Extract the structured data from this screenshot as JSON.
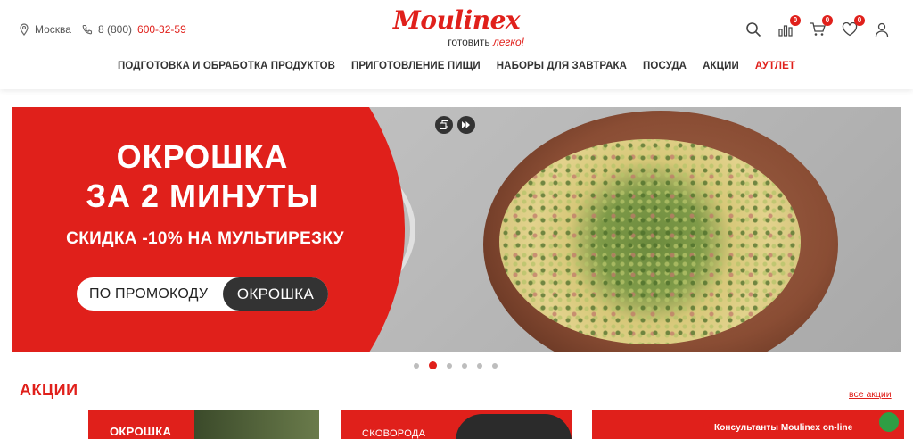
{
  "header": {
    "city": "Москва",
    "phone_prefix": "8 (800) ",
    "phone_number": "600-32-59",
    "brand": "Moulinex",
    "tagline_main": "готовить ",
    "tagline_accent": "легко!",
    "icons": [
      "search-icon",
      "compare-icon",
      "cart-icon",
      "heart-icon",
      "user-icon"
    ],
    "badges": {
      "compare": "0",
      "cart": "0",
      "favorites": "0"
    }
  },
  "nav": {
    "items": [
      "ПОДГОТОВКА И ОБРАБОТКА ПРОДУКТОВ",
      "ПРИГОТОВЛЕНИЕ ПИЩИ",
      "НАБОРЫ ДЛЯ ЗАВТРАКА",
      "ПОСУДА",
      "АКЦИИ",
      "АУТЛЕТ"
    ]
  },
  "hero": {
    "title_line1": "ОКРОШКА",
    "title_line2": "ЗА 2 МИНУТЫ",
    "subtitle": "СКИДКА -10% НА МУЛЬТИРЕЗКУ",
    "promo_label": "ПО ПРОМОКОДУ",
    "promo_code": "ОКРОШКА",
    "slides_total": 6,
    "active_slide": 2
  },
  "promotions": {
    "title": "АКЦИИ",
    "all_link": "все акции",
    "cards": [
      {
        "title": "ОКРОШКА"
      },
      {
        "title": "СКОВОРОДА"
      },
      {
        "title": ""
      }
    ]
  },
  "chat": {
    "label": "Консультанты Moulinex on-line"
  },
  "colors": {
    "accent": "#e0201b",
    "dark": "#333333"
  }
}
